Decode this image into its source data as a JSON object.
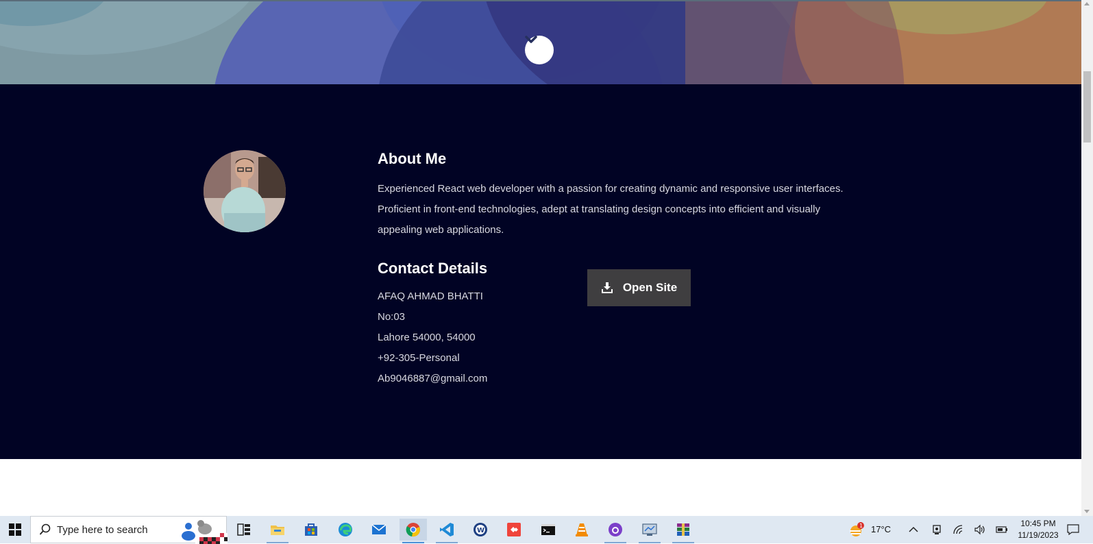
{
  "colors": {
    "about_bg": "#010324",
    "button_bg": "#3f3e40",
    "taskbar_bg": "#dfe8f2"
  },
  "hero": {
    "scroll_icon": "chevron-down-icon"
  },
  "about": {
    "title": "About Me",
    "bio": "Experienced React web developer with a passion for creating dynamic and responsive user interfaces. Proficient in front-end technologies, adept at translating design concepts into efficient and visually appealing web applications."
  },
  "contact": {
    "title": "Contact Details",
    "items": [
      "AFAQ AHMAD BHATTI",
      "No:03",
      "Lahore 54000, 54000",
      "+92-305-Personal",
      "Ab9046887@gmail.com"
    ],
    "button_label": "Open Site",
    "button_icon": "download-icon"
  },
  "taskbar": {
    "search_placeholder": "Type here to search",
    "apps": [
      {
        "name": "task-view-icon"
      },
      {
        "name": "file-explorer-icon"
      },
      {
        "name": "microsoft-store-icon"
      },
      {
        "name": "edge-icon"
      },
      {
        "name": "mail-icon"
      },
      {
        "name": "chrome-icon"
      },
      {
        "name": "vscode-icon"
      },
      {
        "name": "wordweb-icon"
      },
      {
        "name": "anydesk-icon"
      },
      {
        "name": "terminal-icon"
      },
      {
        "name": "vlc-icon"
      },
      {
        "name": "github-desktop-icon"
      },
      {
        "name": "remote-desktop-icon"
      },
      {
        "name": "winrar-icon"
      }
    ],
    "weather_badge": "1",
    "temperature": "17°C",
    "time": "10:45 PM",
    "date": "11/19/2023"
  }
}
